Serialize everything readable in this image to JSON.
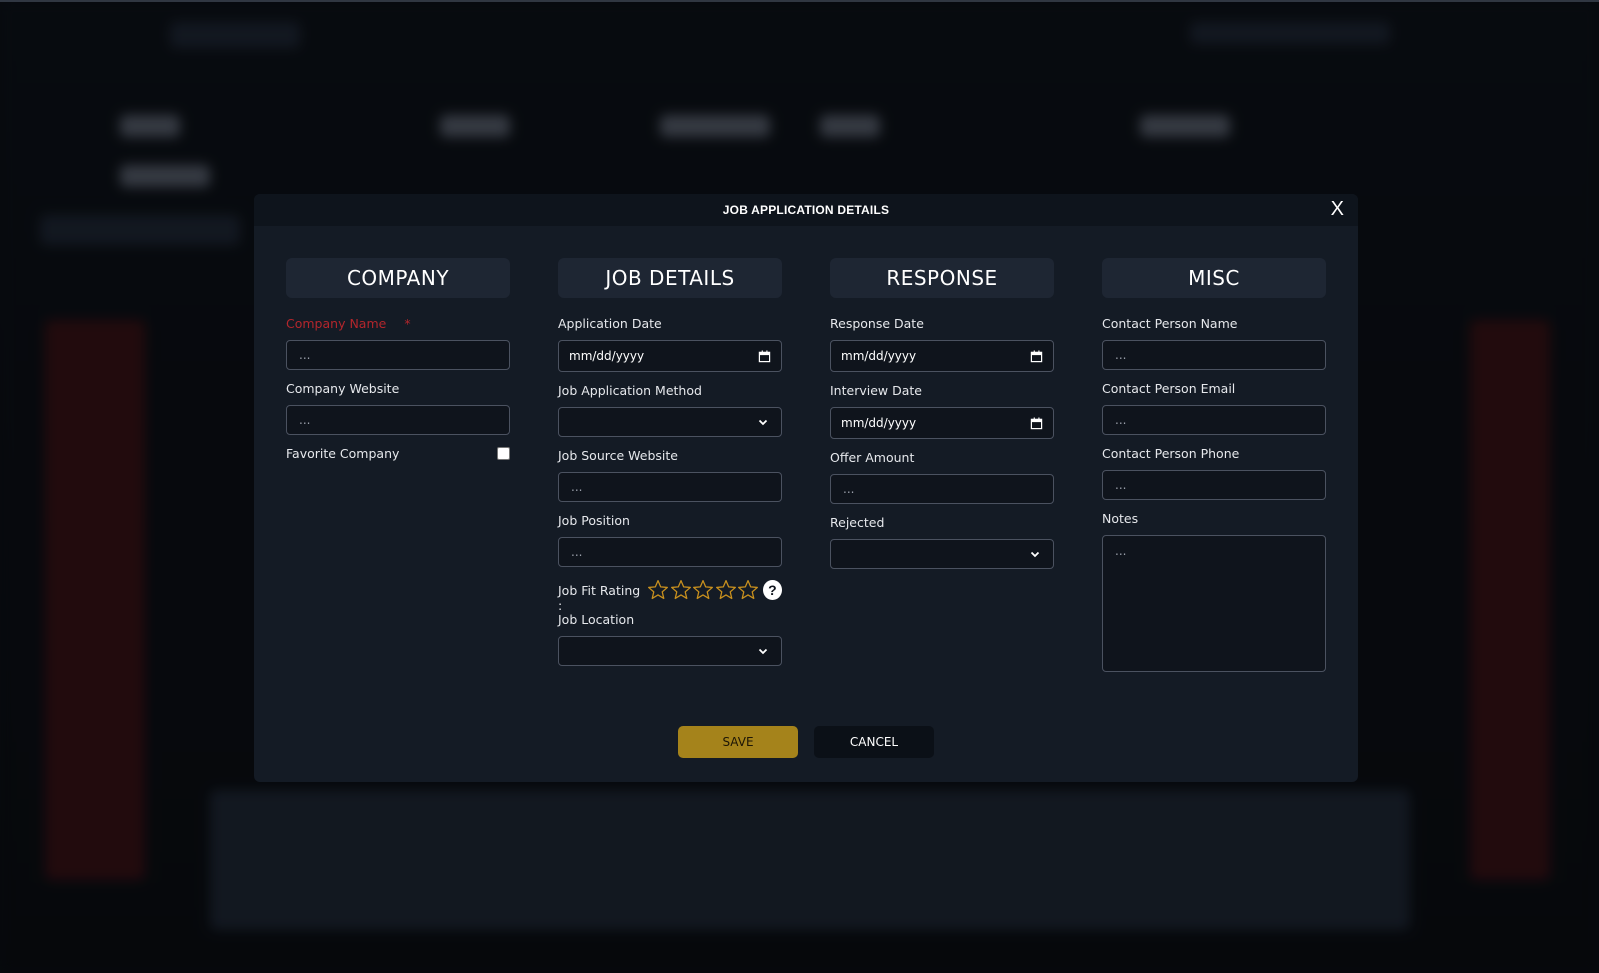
{
  "modal": {
    "title": "JOB APPLICATION DETAILS",
    "close_label": "X",
    "save_label": "SAVE",
    "cancel_label": "CANCEL"
  },
  "company": {
    "heading": "COMPANY",
    "company_name_label": "Company Name",
    "company_name_required": "*",
    "company_name_value": "...",
    "company_website_label": "Company Website",
    "company_website_value": "...",
    "favorite_label": "Favorite Company",
    "favorite_checked": false
  },
  "job_details": {
    "heading": "JOB DETAILS",
    "application_date_label": "Application Date",
    "application_date_value": "mm/dd/yyyy",
    "method_label": "Job Application Method",
    "method_value": "",
    "source_label": "Job Source Website",
    "source_value": "...",
    "position_label": "Job Position",
    "position_value": "...",
    "fit_rating_label": "Job Fit Rating :",
    "fit_rating_value": 0,
    "fit_rating_max": 5,
    "help_label": "?",
    "location_label": "Job Location",
    "location_value": ""
  },
  "response": {
    "heading": "RESPONSE",
    "response_date_label": "Response Date",
    "response_date_value": "mm/dd/yyyy",
    "interview_date_label": "Interview Date",
    "interview_date_value": "mm/dd/yyyy",
    "offer_amount_label": "Offer Amount",
    "offer_amount_value": "...",
    "rejected_label": "Rejected",
    "rejected_value": ""
  },
  "misc": {
    "heading": "MISC",
    "contact_name_label": "Contact Person Name",
    "contact_name_value": "...",
    "contact_email_label": "Contact Person Email",
    "contact_email_value": "...",
    "contact_phone_label": "Contact Person Phone",
    "contact_phone_value": "...",
    "notes_label": "Notes",
    "notes_value": "..."
  },
  "colors": {
    "accent": "#a5831b",
    "star": "#c8901e",
    "required": "#b3262c"
  }
}
